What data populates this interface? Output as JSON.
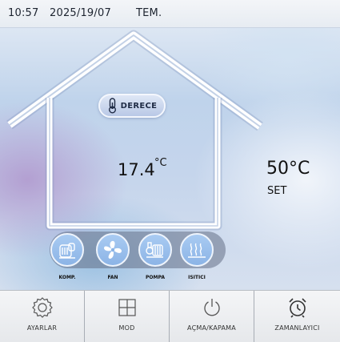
{
  "status_bar": {
    "time": "10:57",
    "date": "2025/19/07",
    "mode": "TEM."
  },
  "indoor": {
    "badge_label": "DERECE",
    "badge_icon": "thermometer-icon",
    "temperature": "17.4",
    "unit": "°C"
  },
  "setpoint": {
    "value": "50°C",
    "label": "SET"
  },
  "devices": [
    {
      "label": "KOMP.",
      "icon": "compressor-icon"
    },
    {
      "label": "FAN",
      "icon": "fan-icon"
    },
    {
      "label": "POMPA",
      "icon": "pump-icon"
    },
    {
      "label": "ISITICI",
      "icon": "heater-icon"
    }
  ],
  "nav": [
    {
      "label": "AYARLAR",
      "icon": "settings-gear-icon"
    },
    {
      "label": "MOD",
      "icon": "mode-grid-icon"
    },
    {
      "label": "AÇMA/KAPAMA",
      "icon": "power-icon"
    },
    {
      "label": "ZAMANLAYICI",
      "icon": "alarm-clock-icon"
    }
  ],
  "colors": {
    "device_fill": "#9cc0ec",
    "house_outline": "#ffffff",
    "nav_background": "#eceef1"
  }
}
